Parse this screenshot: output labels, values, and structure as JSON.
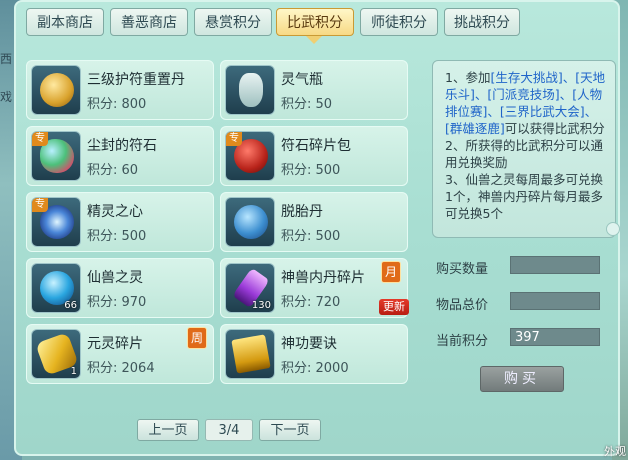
{
  "tabs": [
    {
      "label": "副本商店",
      "active": false
    },
    {
      "label": "善恶商店",
      "active": false
    },
    {
      "label": "悬赏积分",
      "active": false
    },
    {
      "label": "比武积分",
      "active": true
    },
    {
      "label": "师徒积分",
      "active": false
    },
    {
      "label": "挑战积分",
      "active": false
    }
  ],
  "left_edge": {
    "char1": "西",
    "char2": "戏"
  },
  "items": [
    {
      "name": "三级护符重置丹",
      "price": "积分: 800",
      "icon": "amulet-pill-icon"
    },
    {
      "name": "灵气瓶",
      "price": "积分: 50",
      "icon": "spirit-vase-icon"
    },
    {
      "name": "尘封的符石",
      "price": "积分: 60",
      "icon": "sealed-rune-stone-icon",
      "tag": "专"
    },
    {
      "name": "符石碎片包",
      "price": "积分: 500",
      "icon": "rune-fragment-bag-icon",
      "tag": "专"
    },
    {
      "name": "精灵之心",
      "price": "积分: 500",
      "icon": "spirit-heart-icon",
      "tag": "专"
    },
    {
      "name": "脱胎丹",
      "price": "积分: 500",
      "icon": "rebirth-pill-icon"
    },
    {
      "name": "仙兽之灵",
      "price": "积分: 970",
      "icon": "beast-soul-orb-icon",
      "qty": "66"
    },
    {
      "name": "神兽内丹碎片",
      "price": "积分: 720",
      "icon": "beast-core-fragment-icon",
      "qty": "130",
      "badge": "月",
      "new": "更新"
    },
    {
      "name": "元灵碎片",
      "price": "积分: 2064",
      "icon": "yuanling-fragment-icon",
      "qty": "1",
      "badge": "周"
    },
    {
      "name": "神功要诀",
      "price": "积分: 2000",
      "icon": "skill-book-icon"
    }
  ],
  "info": {
    "p1_prefix": "1、参加",
    "links": [
      "[生存大挑战]",
      "、",
      "[天地乐斗]",
      "、",
      "[门派竞技场]",
      "、",
      "[人物排位赛]",
      "、",
      "[三界比武大会]",
      "、",
      "[群雄逐鹿]"
    ],
    "p1_suffix": "可以获得比武积分",
    "p2": "2、所获得的比武积分可以通用兑换奖励",
    "p3": "3、仙兽之灵每周最多可兑换1个，神兽内丹碎片每月最多可兑换5个"
  },
  "fields": {
    "buy_qty_label": "购买数量",
    "buy_qty_value": "",
    "total_label": "物品总价",
    "total_value": "",
    "current_label": "当前积分",
    "current_value": "397"
  },
  "buy_label": "购买",
  "pager": {
    "prev": "上一页",
    "page": "3/4",
    "next": "下一页"
  },
  "corner_text": "外观",
  "colors": {
    "accent": "#f7d985",
    "link": "#1f64c9",
    "badge": "#e06a18"
  }
}
